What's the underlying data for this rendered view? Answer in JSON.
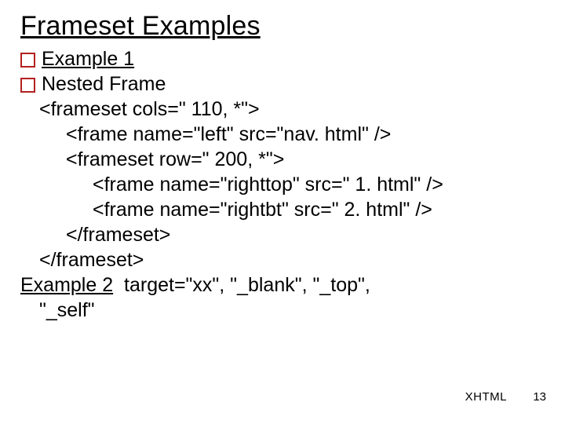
{
  "title": "Frameset Examples",
  "bullets": {
    "example1": "Example 1",
    "nested": "Nested Frame"
  },
  "code": {
    "l1": "<frameset cols=\" 110, *\">",
    "l2": "<frame name=\"left\" src=\"nav. html\" />",
    "l3": "<frameset row=\" 200, *\">",
    "l4": "<frame name=\"righttop\" src=\" 1. html\" />",
    "l5": "<frame name=\"rightbt\" src=\" 2. html\" />",
    "l6": "</frameset>",
    "l7": "</frameset>"
  },
  "example2": {
    "label": "Example 2",
    "rest_part1": "  target=\"xx\", \"_blank\", \"_top\",",
    "rest_part2": "\"_self\""
  },
  "footer": {
    "topic": "XHTML",
    "page": "13"
  }
}
